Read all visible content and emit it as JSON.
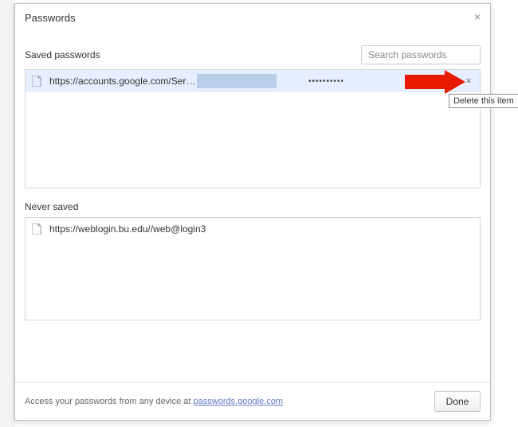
{
  "dialog": {
    "title": "Passwords",
    "close_glyph": "×"
  },
  "saved": {
    "title": "Saved passwords",
    "search_placeholder": "Search passwords",
    "rows": [
      {
        "url": "https://accounts.google.com/Servic…",
        "password_mask": "••••••••••"
      }
    ],
    "delete_glyph": "×"
  },
  "never": {
    "title": "Never saved",
    "rows": [
      {
        "url": "https://weblogin.bu.edu//web@login3"
      }
    ]
  },
  "footer": {
    "text_prefix": "Access your passwords from any device at ",
    "link_text": "passwords.google.com",
    "done_label": "Done"
  },
  "tooltip": "Delete this item"
}
